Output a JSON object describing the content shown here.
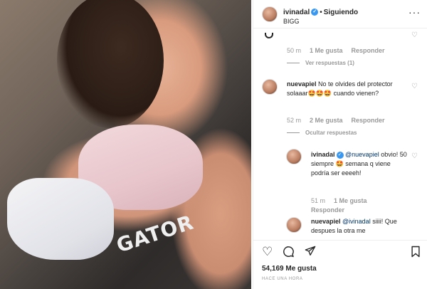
{
  "post": {
    "username": "ivinadal",
    "follow_status": "Siguiendo",
    "location": "BIGG",
    "photo_brand_text": "GATOR"
  },
  "comments": {
    "first": {
      "time": "50 m",
      "likes": "1 Me gusta",
      "reply": "Responder",
      "view_replies": "Ver respuestas (1)"
    },
    "second": {
      "username": "nuevapiel",
      "text": "No te olvides del protector solaaar🤩🤩🤩 cuando vienen?",
      "time": "52 m",
      "likes": "2 Me gusta",
      "reply": "Responder",
      "hide_replies": "Ocultar respuestas"
    },
    "reply1": {
      "username": "ivinadal",
      "mention": "@nuevapiel",
      "text": "obvio! 50 siempre 🤩 semana q viene podría ser eeeeh!",
      "time": "51 m",
      "likes": "1 Me gusta",
      "reply": "Responder"
    },
    "reply2": {
      "username": "nuevapiel",
      "mention": "@ivinadal",
      "text": "siiii! Que despues la otra me"
    }
  },
  "footer": {
    "likes": "54,169 Me gusta",
    "timestamp": "HACE UNA HORA"
  },
  "icons": {
    "like": "heart-icon",
    "comment": "comment-icon",
    "share": "share-icon",
    "save": "bookmark-icon"
  },
  "colors": {
    "link_blue": "#003569",
    "verified_blue": "#3897f0",
    "muted_gray": "#999999"
  }
}
